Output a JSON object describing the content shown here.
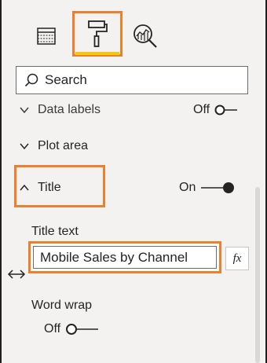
{
  "tabs": [
    {
      "name": "fields-icon"
    },
    {
      "name": "format-paint-roller-icon",
      "selected": true
    },
    {
      "name": "analytics-magnifier-icon"
    }
  ],
  "search": {
    "placeholder": "Search"
  },
  "sections": {
    "data_labels": {
      "label": "Data labels",
      "toggle_label": "Off",
      "expanded": false
    },
    "plot_area": {
      "label": "Plot area",
      "expanded": false
    },
    "title": {
      "label": "Title",
      "toggle_label": "On",
      "expanded": true
    }
  },
  "title_settings": {
    "title_text_label": "Title text",
    "title_text_value": "Mobile Sales by Channel",
    "fx_label": "fx",
    "word_wrap_label": "Word wrap",
    "word_wrap_toggle_label": "Off"
  },
  "colors": {
    "highlight": "#f07f2c",
    "accent_underline": "#f2c811",
    "panel_bg": "#f3f2f1",
    "text": "#252423"
  }
}
